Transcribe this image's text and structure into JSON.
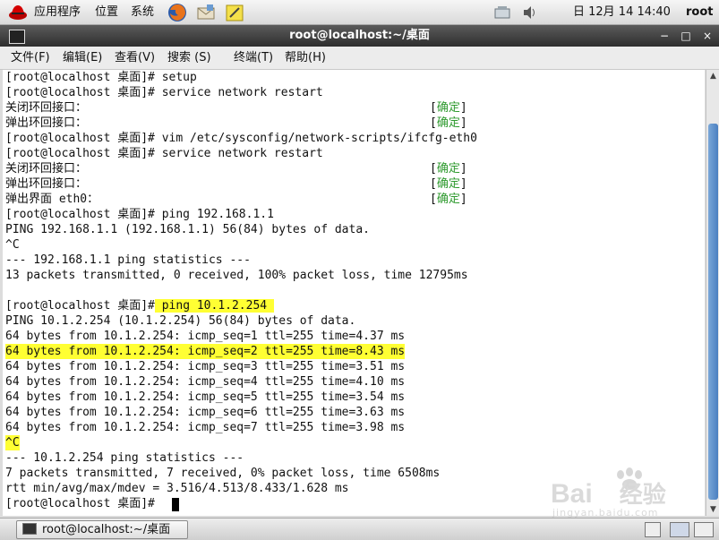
{
  "top_panel": {
    "apps_label": "应用程序",
    "places_label": "位置",
    "system_label": "系统",
    "clock": "日 12月 14 14:40",
    "user": "root"
  },
  "window": {
    "title": "root@localhost:~/桌面",
    "minimize": "−",
    "maximize": "□",
    "close": "×"
  },
  "menubar": {
    "items": [
      "文件(F)",
      "编辑(E)",
      "查看(V)",
      "搜索 (S)",
      "终端(T)",
      "帮助(H)"
    ]
  },
  "terminal": {
    "lines": [
      "[root@localhost 桌面]# setup",
      "[root@localhost 桌面]# service network restart",
      "关闭环回接口：",
      "弹出环回接口：",
      "[root@localhost 桌面]# vim /etc/sysconfig/network-scripts/ifcfg-eth0",
      "[root@localhost 桌面]# service network restart",
      "关闭环回接口：",
      "弹出环回接口：",
      "弹出界面 eth0：",
      "[root@localhost 桌面]# ping 192.168.1.1",
      "PING 192.168.1.1 (192.168.1.1) 56(84) bytes of data.",
      "^C",
      "--- 192.168.1.1 ping statistics ---",
      "13 packets transmitted, 0 received, 100% packet loss, time 12795ms",
      "",
      "[root@localhost 桌面]#",
      "PING 10.1.2.254 (10.1.2.254) 56(84) bytes of data.",
      "64 bytes from 10.1.2.254: icmp_seq=1 ttl=255 time=4.37 ms",
      "64 bytes from 10.1.2.254: icmp_seq=2 ttl=255 time=8.43 ms",
      "64 bytes from 10.1.2.254: icmp_seq=3 ttl=255 time=3.51 ms",
      "64 bytes from 10.1.2.254: icmp_seq=4 ttl=255 time=4.10 ms",
      "64 bytes from 10.1.2.254: icmp_seq=5 ttl=255 time=3.54 ms",
      "64 bytes from 10.1.2.254: icmp_seq=6 ttl=255 time=3.63 ms",
      "64 bytes from 10.1.2.254: icmp_seq=7 ttl=255 time=3.98 ms",
      "^C",
      "--- 10.1.2.254 ping statistics ---",
      "7 packets transmitted, 7 received, 0% packet loss, time 6508ms",
      "rtt min/avg/max/mdev = 3.516/4.513/8.433/1.628 ms",
      "[root@localhost 桌面]#"
    ],
    "highlighted_command": " ping 10.1.2.254 ",
    "status_bracket_open": "[",
    "status_ok": "确定",
    "status_bracket_close": "]"
  },
  "taskbar": {
    "task_label": "root@localhost:~/桌面"
  },
  "watermark": {
    "brand": "Bai",
    "brand_suffix": "经验",
    "url": "jingyan.baidu.com"
  }
}
